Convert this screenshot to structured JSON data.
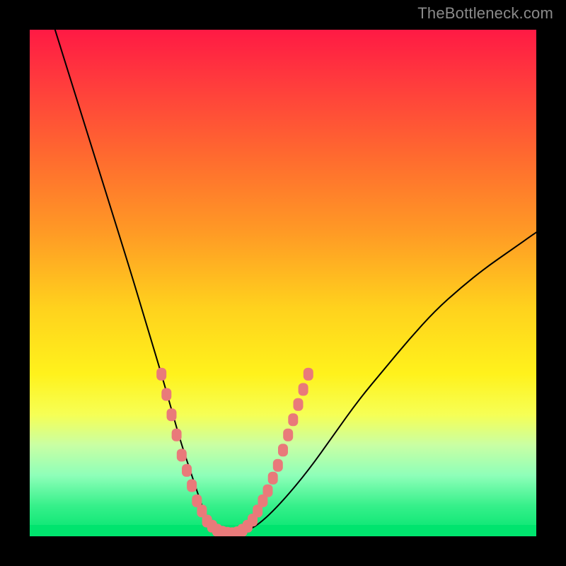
{
  "watermark": "TheBottleneck.com",
  "colors": {
    "curve_stroke": "#000000",
    "marker_fill": "#e97a7a",
    "background_black": "#000000"
  },
  "chart_data": {
    "type": "line",
    "title": "",
    "xlabel": "",
    "ylabel": "",
    "xlim": [
      0,
      100
    ],
    "ylim": [
      0,
      100
    ],
    "grid": false,
    "legend": false,
    "axes_visible": false,
    "series": [
      {
        "name": "bottleneck-curve",
        "x": [
          5,
          10,
          15,
          20,
          23,
          26,
          28,
          30,
          32,
          33,
          34,
          35,
          36,
          38,
          40,
          43,
          46,
          50,
          55,
          60,
          65,
          70,
          75,
          80,
          85,
          90,
          95,
          100
        ],
        "values": [
          100,
          84,
          68,
          52,
          42,
          32,
          25,
          18,
          12,
          9,
          6,
          3.5,
          2,
          1,
          0.5,
          1,
          3,
          7,
          13,
          20,
          27,
          33,
          39,
          44.5,
          49,
          53,
          56.5,
          60
        ]
      }
    ],
    "markers": [
      {
        "name": "near-bottom-points",
        "shape": "rounded-rect",
        "color": "#e97a7a",
        "points": [
          {
            "x": 26,
            "y": 32
          },
          {
            "x": 27,
            "y": 28
          },
          {
            "x": 28,
            "y": 24
          },
          {
            "x": 29,
            "y": 20
          },
          {
            "x": 30,
            "y": 16
          },
          {
            "x": 31,
            "y": 13
          },
          {
            "x": 32,
            "y": 10
          },
          {
            "x": 33,
            "y": 7
          },
          {
            "x": 34,
            "y": 5
          },
          {
            "x": 35,
            "y": 3
          },
          {
            "x": 36,
            "y": 2
          },
          {
            "x": 37,
            "y": 1.2
          },
          {
            "x": 38,
            "y": 0.8
          },
          {
            "x": 39,
            "y": 0.6
          },
          {
            "x": 40,
            "y": 0.5
          },
          {
            "x": 41,
            "y": 0.7
          },
          {
            "x": 42,
            "y": 1.2
          },
          {
            "x": 43,
            "y": 2
          },
          {
            "x": 44,
            "y": 3.2
          },
          {
            "x": 45,
            "y": 5
          },
          {
            "x": 46,
            "y": 7
          },
          {
            "x": 47,
            "y": 9
          },
          {
            "x": 48,
            "y": 11.5
          },
          {
            "x": 49,
            "y": 14
          },
          {
            "x": 50,
            "y": 17
          },
          {
            "x": 51,
            "y": 20
          },
          {
            "x": 52,
            "y": 23
          },
          {
            "x": 53,
            "y": 26
          },
          {
            "x": 54,
            "y": 29
          },
          {
            "x": 55,
            "y": 32
          }
        ]
      }
    ]
  }
}
